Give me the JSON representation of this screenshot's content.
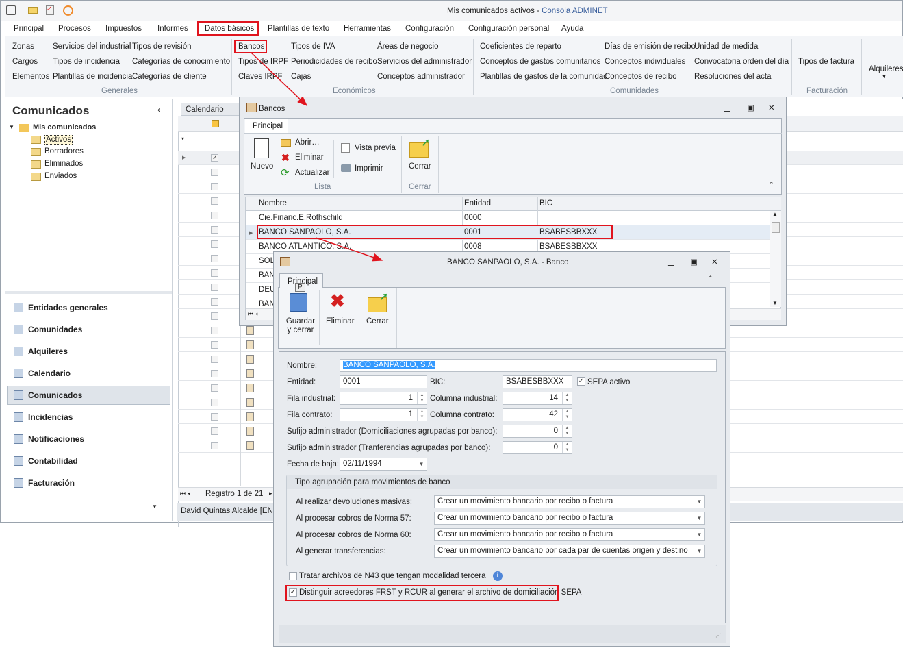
{
  "title": {
    "doc": "Mis comunicados activos",
    "app": "Consola ADMINET"
  },
  "menu": [
    "Principal",
    "Procesos",
    "Impuestos",
    "Informes",
    "Datos básicos",
    "Plantillas de texto",
    "Herramientas",
    "Configuración",
    "Configuración personal",
    "Ayuda"
  ],
  "ribbon": {
    "generales": {
      "label": "Generales",
      "items": [
        "Zonas",
        "Cargos",
        "Elementos",
        "Servicios del industrial",
        "Tipos de incidencia",
        "Plantillas de incidencia",
        "Tipos de revisión",
        "Categorías de conocimiento",
        "Categorías de cliente"
      ]
    },
    "economicos": {
      "label": "Económicos",
      "items": [
        "Bancos",
        "Tipos de IRPF",
        "Claves IRPF",
        "Tipos de IVA",
        "Periodicidades de recibo",
        "Cajas",
        "Áreas de negocio",
        "Servicios del administrador",
        "Conceptos administrador"
      ]
    },
    "comunidades": {
      "label": "Comunidades",
      "items": [
        "Coeficientes de reparto",
        "Conceptos de gastos comunitarios",
        "Plantillas de gastos de la comunidad",
        "Días de emisión de recibo",
        "Conceptos individuales",
        "Conceptos de recibo",
        "Unidad de medida",
        "Convocatoria orden del día",
        "Resoluciones del acta"
      ]
    },
    "facturacion": {
      "label": "Facturación",
      "items": [
        "Tipos de factura"
      ]
    },
    "alquileres": "Alquileres"
  },
  "left": {
    "title": "Comunicados",
    "tree_root": "Mis comunicados",
    "tree": [
      "Activos",
      "Borradores",
      "Eliminados",
      "Enviados"
    ],
    "nav": [
      "Entidades generales",
      "Comunidades",
      "Alquileres",
      "Calendario",
      "Comunicados",
      "Incidencias",
      "Notificaciones",
      "Contabilidad",
      "Facturación"
    ]
  },
  "grid": {
    "tab": "Calendario",
    "pager": "Registro 1 de 21",
    "status": "David Quintas Alcalde [ENRI"
  },
  "bancos": {
    "title": "Bancos",
    "tab": "Principal",
    "new": "Nuevo",
    "open": "Abrir…",
    "delete": "Eliminar",
    "refresh": "Actualizar",
    "preview": "Vista previa",
    "print": "Imprimir",
    "close": "Cerrar",
    "group_list": "Lista",
    "group_close": "Cerrar",
    "columns": [
      "Nombre",
      "Entidad",
      "BIC"
    ],
    "rows": [
      [
        "Cie.Financ.E.Rothschild",
        "0000",
        ""
      ],
      [
        "BANCO SANPAOLO, S.A.",
        "0001",
        "BSABESBBXXX"
      ],
      [
        "BANCO ATLANTICO, S.A.",
        "0008",
        "BSABESBBXXX"
      ],
      [
        "SOLE",
        "",
        ""
      ],
      [
        "BANC",
        "",
        ""
      ],
      [
        "DEUT",
        "",
        ""
      ],
      [
        "BANC",
        "",
        ""
      ]
    ]
  },
  "dialog": {
    "title": "BANCO SANPAOLO, S.A. - Banco",
    "tab": "Principal",
    "keytip": "P",
    "save": "Guardar y cerrar",
    "delete": "Eliminar",
    "close": "Cerrar",
    "fields": {
      "nombre_l": "Nombre:",
      "nombre": "BANCO SANPAOLO, S.A.",
      "entidad_l": "Entidad:",
      "entidad": "0001",
      "bic_l": "BIC:",
      "bic": "BSABESBBXXX",
      "sepa": "SEPA activo",
      "fila_ind_l": "Fila industrial:",
      "fila_ind": "1",
      "col_ind_l": "Columna industrial:",
      "col_ind": "14",
      "fila_con_l": "Fila contrato:",
      "fila_con": "1",
      "col_con_l": "Columna contrato:",
      "col_con": "42",
      "suf_dom_l": "Sufijo administrador (Domiciliaciones agrupadas por banco):",
      "suf_dom": "0",
      "suf_tra_l": "Sufijo administrador (Tranferencias agrupadas por banco):",
      "suf_tra": "0",
      "fecha_l": "Fecha de baja:",
      "fecha": "02/11/1994"
    },
    "group": {
      "title": "Tipo agrupación para movimientos de banco",
      "rows": [
        {
          "label": "Al realizar devoluciones masivas:",
          "value": "Crear un movimiento bancario por recibo o factura"
        },
        {
          "label": "Al procesar cobros de Norma 57:",
          "value": "Crear un movimiento bancario por recibo o factura"
        },
        {
          "label": "Al procesar cobros de Norma 60:",
          "value": "Crear un movimiento bancario por recibo o factura"
        },
        {
          "label": "Al generar transferencias:",
          "value": "Crear un movimiento bancario por cada par de cuentas origen y destino"
        }
      ]
    },
    "check_n43": "Tratar archivos de N43 que tengan modalidad tercera",
    "check_n43_value": false,
    "check_frst": "Distinguir acreedores FRST y RCUR al generar el archivo de domiciliación SEPA",
    "check_frst_value": true,
    "sepa_value": true
  },
  "colors": {
    "highlight": "#e0141e",
    "selection": "#3399ff"
  }
}
